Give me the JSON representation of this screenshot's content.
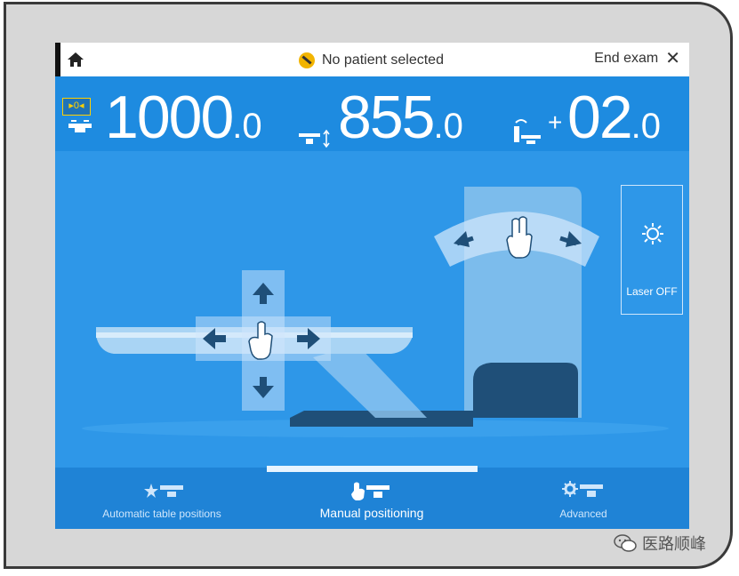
{
  "topbar": {
    "status_text": "No patient selected",
    "end_exam_label": "End exam"
  },
  "readout": {
    "zero_badge": "▸0◂",
    "value1_int": "1000",
    "value1_dec": ".0",
    "value2_int": "855",
    "value2_dec": ".0",
    "value3_sign": "+",
    "value3_int": "02",
    "value3_dec": ".0"
  },
  "laser": {
    "label": "Laser OFF"
  },
  "tabs": [
    {
      "label": "Automatic table positions"
    },
    {
      "label": "Manual positioning"
    },
    {
      "label": "Advanced"
    }
  ],
  "watermark": {
    "text": "医路顺峰"
  },
  "colors": {
    "accent": "#2c95e6",
    "badge_border": "#ffd000"
  }
}
